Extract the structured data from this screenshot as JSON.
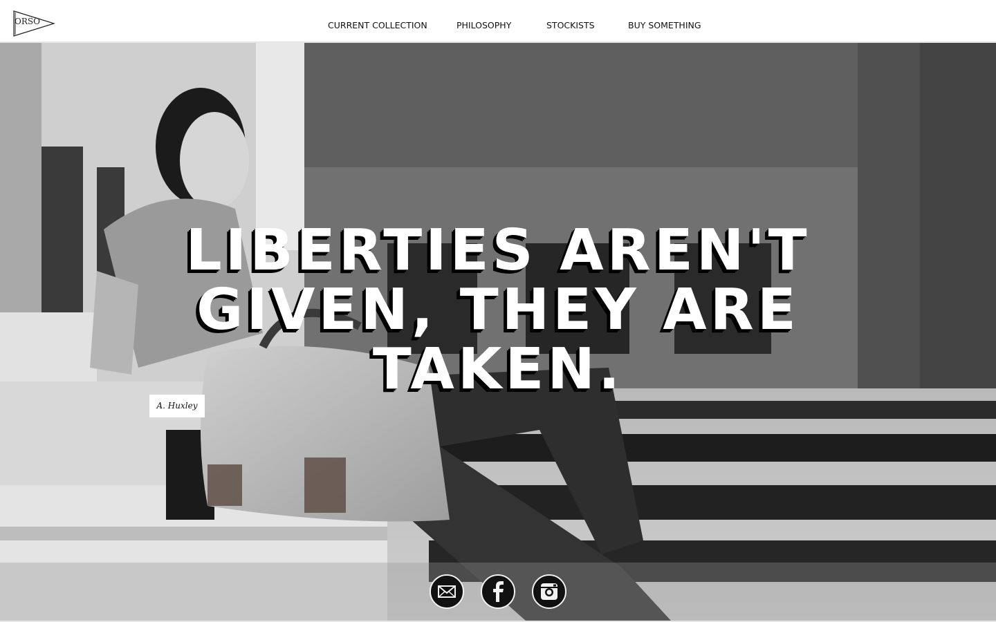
{
  "brand": {
    "logo_text": "ORSO",
    "logo_icon": "pennant-icon"
  },
  "nav": {
    "items": [
      {
        "label": "CURRENT COLLECTION"
      },
      {
        "label": "PHILOSOPHY"
      },
      {
        "label": "STOCKISTS"
      },
      {
        "label": "BUY SOMETHING"
      }
    ]
  },
  "hero": {
    "quote": "LIBERTIES AREN'T GIVEN, THEY ARE TAKEN.",
    "author": "A. Huxley"
  },
  "social": {
    "icons": [
      "mail-icon",
      "facebook-icon",
      "instagram-icon"
    ]
  }
}
